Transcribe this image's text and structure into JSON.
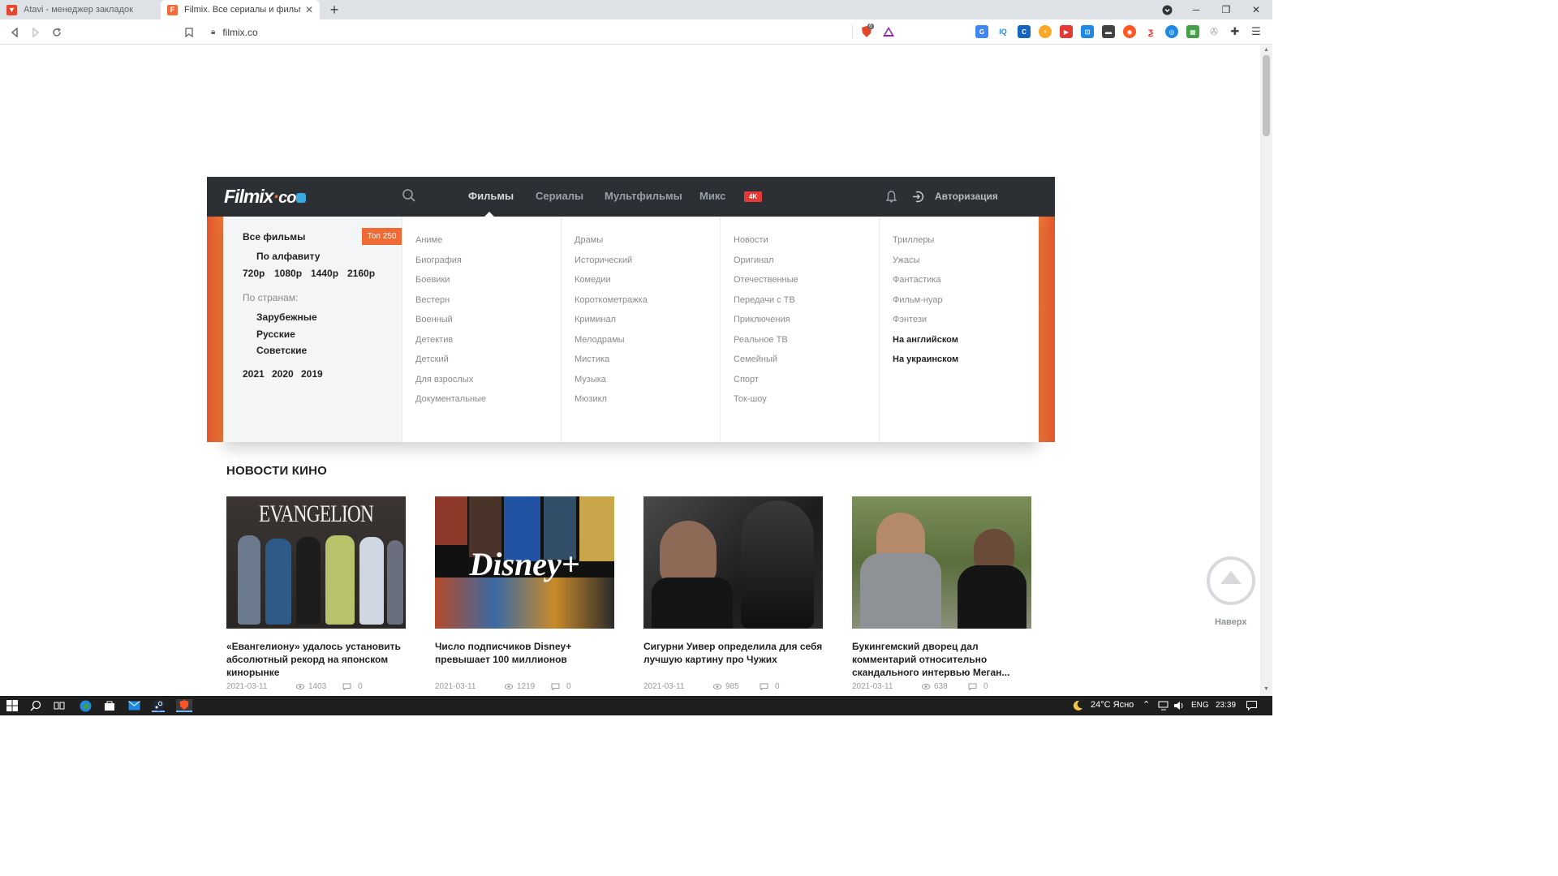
{
  "browser": {
    "tabs": [
      {
        "title": "Atavi - менеджер закладок",
        "active": false,
        "favicon_color": "#e5462c"
      },
      {
        "title": "Filmix. Все сериалы и фильмы п",
        "active": true,
        "favicon_color": "#f26b38",
        "favicon_letter": "F"
      }
    ],
    "new_tab_label": "+",
    "url": "filmix.co",
    "shield_count": "6"
  },
  "site": {
    "logo": {
      "text": "Filmix",
      "dot": "·",
      "tld": "co"
    },
    "nav": [
      {
        "label": "Фильмы",
        "active": true
      },
      {
        "label": "Сериалы",
        "active": false
      },
      {
        "label": "Мультфильмы",
        "active": false
      },
      {
        "label": "Микс",
        "active": false
      }
    ],
    "badge_4k": "4K",
    "login_label": "Авторизация",
    "accent": "#f06a35"
  },
  "dropdown": {
    "all_films": "Все фильмы",
    "top250": "Топ 250",
    "by_alphabet": "По алфавиту",
    "quality": [
      "720p",
      "1080p",
      "1440p",
      "2160p"
    ],
    "by_country_label": "По странам:",
    "countries": [
      "Зарубежные",
      "Русские",
      "Советские"
    ],
    "years": [
      "2021",
      "2020",
      "2019"
    ],
    "genre_columns": [
      [
        "Аниме",
        "Биография",
        "Боевики",
        "Вестерн",
        "Военный",
        "Детектив",
        "Детский",
        "Для взрослых",
        "Документальные"
      ],
      [
        "Драмы",
        "Исторический",
        "Комедии",
        "Короткометражка",
        "Криминал",
        "Мелодрамы",
        "Мистика",
        "Музыка",
        "Мюзикл"
      ],
      [
        "Новости",
        "Оригинал",
        "Отечественные",
        "Передачи с ТВ",
        "Приключения",
        "Реальное ТВ",
        "Семейный",
        "Спорт",
        "Ток-шоу"
      ],
      [
        "Триллеры",
        "Ужасы",
        "Фантастика",
        "Фильм-нуар",
        "Фэнтези"
      ]
    ],
    "language_links": [
      "На английском",
      "На украинском"
    ]
  },
  "news": {
    "heading": "НОВОСТИ КИНО",
    "cards": [
      {
        "title": "«Евангелиону» удалось установить абсолютный рекорд на японском кинорынке",
        "date": "2021-03-11",
        "views": "1403",
        "comments": "0",
        "thumb_text": "EVANGELION"
      },
      {
        "title": "Число подписчиков Disney+ превышает 100 миллионов",
        "date": "2021-03-11",
        "views": "1219",
        "comments": "0",
        "thumb_text": "Disney+"
      },
      {
        "title": "Сигурни Уивер определила для себя лучшую картину про Чужих",
        "date": "2021-03-11",
        "views": "985",
        "comments": "0",
        "thumb_text": ""
      },
      {
        "title": "Букингемский дворец дал комментарий относительно скандального интервью Меган...",
        "date": "2021-03-11",
        "views": "638",
        "comments": "0",
        "thumb_text": ""
      }
    ]
  },
  "scroll_top_label": "Наверх",
  "taskbar": {
    "weather": "24°C Ясно",
    "lang": "ENG",
    "time": "23:39"
  }
}
